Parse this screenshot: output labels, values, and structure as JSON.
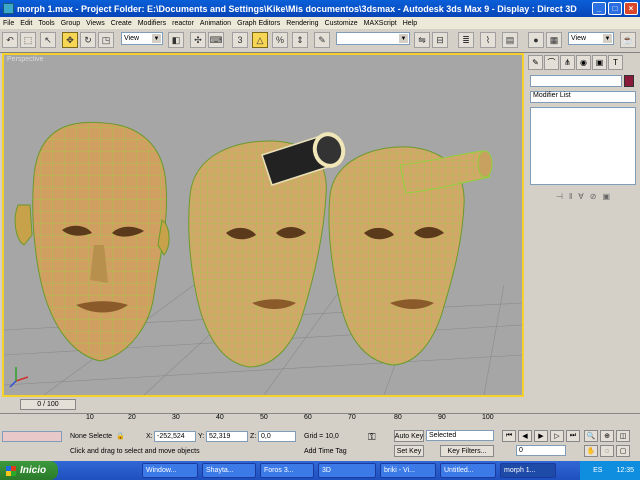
{
  "window": {
    "title": "morph 1.max    - Project Folder: E:\\Documents and Settings\\Kike\\Mis documentos\\3dsmax    - Autodesk 3ds Max 9    - Display : Direct 3D"
  },
  "menu": [
    "File",
    "Edit",
    "Tools",
    "Group",
    "Views",
    "Create",
    "Modifiers",
    "reactor",
    "Animation",
    "Graph Editors",
    "Rendering",
    "Customize",
    "MAXScript",
    "Help"
  ],
  "toolbar": {
    "ref_coord": "View",
    "named_selection": "",
    "render_view": "View"
  },
  "viewport": {
    "label": "Perspective",
    "colors": {
      "border": "#f5d12b",
      "background": "#a6a6a6",
      "mesh_fill": "#d2a86a",
      "wire": "#8fd03a"
    }
  },
  "command_panel": {
    "modifier_list": "Modifier List",
    "tab_icons": [
      "arrow-icon",
      "bend-icon",
      "hierarchy-icon",
      "motion-icon",
      "display-icon",
      "utilities-icon"
    ]
  },
  "time": {
    "slider_label": "0 / 100",
    "ticks": [
      "10",
      "20",
      "30",
      "40",
      "50",
      "60",
      "70",
      "80",
      "90",
      "100"
    ]
  },
  "status": {
    "selection": "None Selecte",
    "x_label": "X:",
    "x_value": "-252,524",
    "y_label": "Y:",
    "y_value": "52,319",
    "z_label": "Z:",
    "z_value": "0,0",
    "grid": "Grid = 10,0",
    "auto_key": "Auto Key",
    "key_mode": "Selected",
    "set_key": "Set Key",
    "key_filters": "Key Filters...",
    "frame": "0",
    "prompt": "Click and drag to select and move objects",
    "time_tag": "Add Time Tag"
  },
  "taskbar": {
    "start": "Inicio",
    "tasks": [
      "Window...",
      "Shayta...",
      "Foros 3...",
      "3D",
      "briki - Vi...",
      "Untitled...",
      "morph 1..."
    ],
    "lang": "ES",
    "clock": "12:35"
  }
}
